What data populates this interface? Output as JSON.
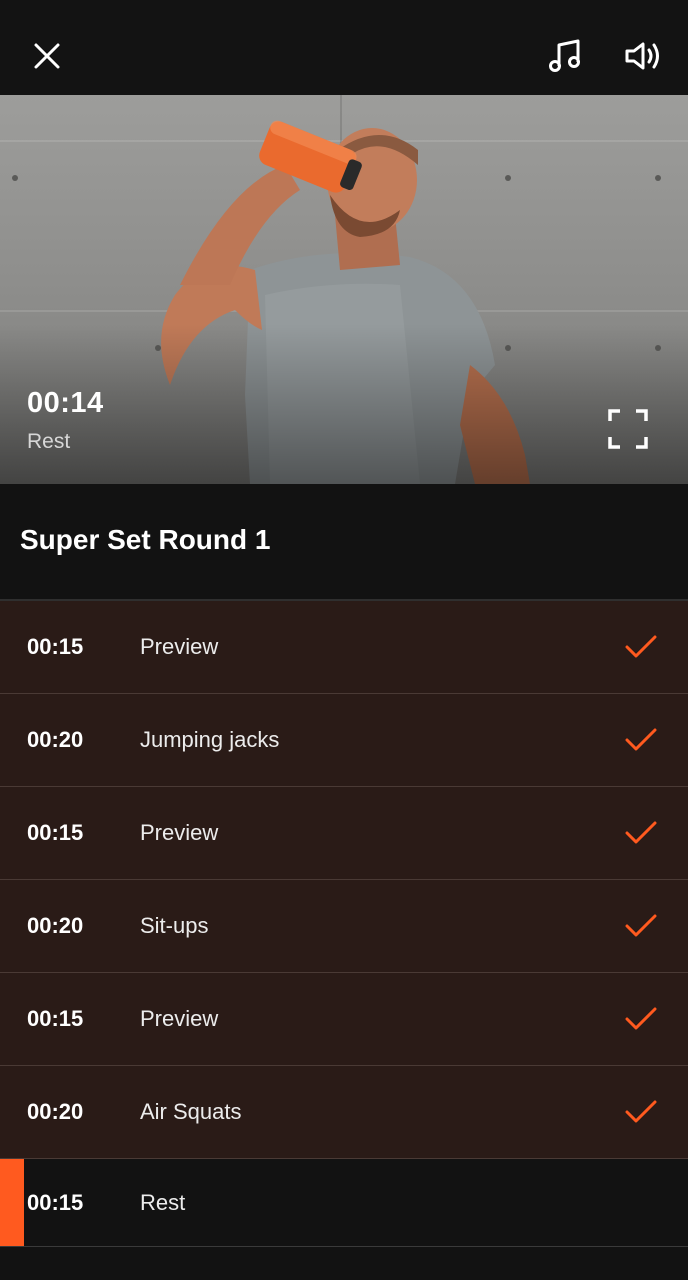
{
  "colors": {
    "accent": "#ff5a1f",
    "background": "#121212",
    "row_background": "#2a1b17"
  },
  "header": {
    "close_icon": "close-icon",
    "music_icon": "music-note-icon",
    "volume_icon": "volume-icon"
  },
  "player": {
    "time": "00:14",
    "phase": "Rest",
    "fullscreen_icon": "fullscreen-icon"
  },
  "section": {
    "title": "Super Set Round 1"
  },
  "exercises": [
    {
      "duration": "00:15",
      "name": "Preview",
      "completed": true
    },
    {
      "duration": "00:20",
      "name": "Jumping jacks",
      "completed": true
    },
    {
      "duration": "00:15",
      "name": "Preview",
      "completed": true
    },
    {
      "duration": "00:20",
      "name": "Sit-ups",
      "completed": true
    },
    {
      "duration": "00:15",
      "name": "Preview",
      "completed": true
    },
    {
      "duration": "00:20",
      "name": "Air Squats",
      "completed": true
    },
    {
      "duration": "00:15",
      "name": "Rest",
      "completed": false,
      "current": true
    }
  ]
}
